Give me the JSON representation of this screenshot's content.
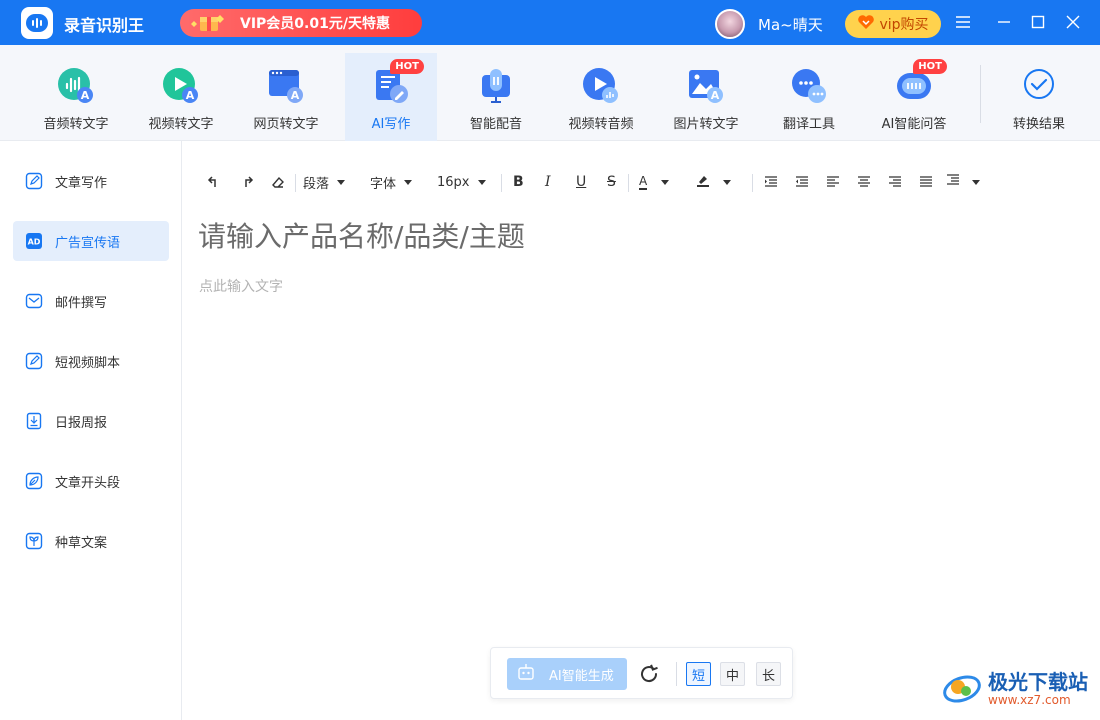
{
  "titlebar": {
    "app_title": "录音识别王",
    "promo": "VIP会员0.01元/天特惠",
    "username": "Ma~晴天",
    "vip_buy": "vip购买"
  },
  "toolbar": {
    "tools": [
      {
        "label": "音频转文字",
        "icon": "audio-to-text-icon"
      },
      {
        "label": "视频转文字",
        "icon": "video-to-text-icon"
      },
      {
        "label": "网页转文字",
        "icon": "web-to-text-icon"
      },
      {
        "label": "AI写作",
        "icon": "ai-writing-icon",
        "badge": "HOT",
        "active": true
      },
      {
        "label": "智能配音",
        "icon": "dubbing-icon"
      },
      {
        "label": "视频转音频",
        "icon": "video-to-audio-icon"
      },
      {
        "label": "图片转文字",
        "icon": "image-to-text-icon"
      },
      {
        "label": "翻译工具",
        "icon": "translate-icon"
      },
      {
        "label": "AI智能问答",
        "icon": "ai-qa-icon",
        "badge": "HOT"
      }
    ],
    "result_label": "转换结果"
  },
  "sidebar": {
    "items": [
      {
        "label": "文章写作",
        "icon": "pen-icon"
      },
      {
        "label": "广告宣传语",
        "icon": "ad-icon",
        "icon_text": "AD",
        "active": true
      },
      {
        "label": "邮件撰写",
        "icon": "mail-icon"
      },
      {
        "label": "短视频脚本",
        "icon": "pen-icon"
      },
      {
        "label": "日报周报",
        "icon": "report-icon"
      },
      {
        "label": "文章开头段",
        "icon": "leaf-icon"
      },
      {
        "label": "种草文案",
        "icon": "sprout-icon"
      }
    ]
  },
  "editor": {
    "toolbar": {
      "paragraph": "段落",
      "font": "字体",
      "font_size": "16px",
      "bold": "B",
      "italic": "I",
      "underline": "U",
      "strike": "S",
      "font_color": "A"
    },
    "title_placeholder": "请输入产品名称/品类/主题",
    "body_placeholder": "点此输入文字"
  },
  "generate": {
    "button": "AI智能生成",
    "lengths": [
      "短",
      "中",
      "长"
    ],
    "selected_length": "短"
  },
  "watermark": {
    "text": "极光下载站",
    "url": "www.xz7.com"
  },
  "colors": {
    "brand_blue": "#1877f2",
    "promo_red": "#ff3d3d",
    "vip_yellow": "#ffd24d",
    "hot_red": "#ff4141"
  }
}
